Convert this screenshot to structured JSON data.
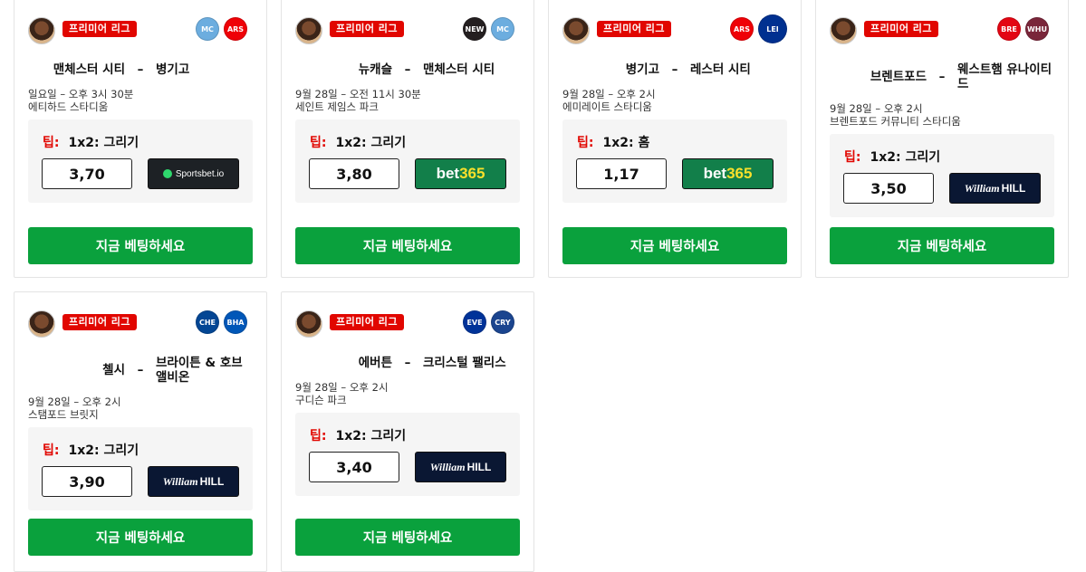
{
  "cards": [
    {
      "league": "프리미어 리그",
      "crest1": {
        "icon": "man-city-crest",
        "color": "#6caddf",
        "abbr": "MC"
      },
      "crest2": {
        "icon": "arsenal-crest",
        "color": "#ef0107",
        "abbr": "ARS"
      },
      "home": "맨체스터 시티",
      "dash": "–",
      "away": "병기고",
      "date": "일요일  – 오후 3시 30분",
      "venue": "에티하드 스타디움",
      "tip_label": "팁:",
      "tip_value": "1x2: 그리기",
      "odds": "3,70",
      "bookmaker": {
        "name": "Sportsbet.io",
        "style": "sportsbet"
      },
      "cta": "지금 베팅하세요"
    },
    {
      "league": "프리미어 리그",
      "crest1": {
        "icon": "newcastle-crest",
        "color": "#241f20",
        "abbr": "NEW"
      },
      "crest2": {
        "icon": "man-city-crest",
        "color": "#6caddf",
        "abbr": "MC"
      },
      "home": "뉴캐슬",
      "dash": "–",
      "away": "맨체스터 시티",
      "date": "9월 28일  – 오전 11시 30분",
      "venue": "세인트 제임스 파크",
      "tip_label": "팁:",
      "tip_value": "1x2: 그리기",
      "odds": "3,80",
      "bookmaker": {
        "name_a": "bet",
        "name_b": "365",
        "style": "bet365"
      },
      "cta": "지금 베팅하세요"
    },
    {
      "league": "프리미어 리그",
      "crest1": {
        "icon": "arsenal-crest",
        "color": "#ef0107",
        "abbr": "ARS"
      },
      "crest2": {
        "icon": "leicester-crest",
        "color": "#003090",
        "abbr": "LEI"
      },
      "home": "병기고",
      "dash": "–",
      "away": "레스터 시티",
      "date": "9월 28일  – 오후 2시",
      "venue": "에미레이트 스타디움",
      "tip_label": "팁:",
      "tip_value": "1x2: 홈",
      "odds": "1,17",
      "bookmaker": {
        "name_a": "bet",
        "name_b": "365",
        "style": "bet365"
      },
      "cta": "지금 베팅하세요"
    },
    {
      "league": "프리미어 리그",
      "crest1": {
        "icon": "brentford-crest",
        "color": "#e30613",
        "abbr": "BRE"
      },
      "crest2": {
        "icon": "west-ham-crest",
        "color": "#7a263a",
        "abbr": "WHU"
      },
      "home": "브렌트포드",
      "dash": "–",
      "away": "웨스트햄 유나이티드",
      "date": "9월 28일  – 오후 2시",
      "venue": "브렌트포드 커뮤니티 스타디움",
      "tip_label": "팁:",
      "tip_value": "1x2: 그리기",
      "odds": "3,50",
      "bookmaker": {
        "name_a": "William",
        "name_b": "HILL",
        "style": "wh"
      },
      "cta": "지금 베팅하세요"
    },
    {
      "league": "프리미어 리그",
      "crest1": {
        "icon": "chelsea-crest",
        "color": "#034694",
        "abbr": "CHE"
      },
      "crest2": {
        "icon": "brighton-crest",
        "color": "#0057b8",
        "abbr": "BHA"
      },
      "home": "첼시",
      "dash": "–",
      "away": "브라이튼 & 호브 앨비온",
      "date": "9월 28일  – 오후 2시",
      "venue": "스탬포드 브릿지",
      "tip_label": "팁:",
      "tip_value": "1x2: 그리기",
      "odds": "3,90",
      "bookmaker": {
        "name_a": "William",
        "name_b": "HILL",
        "style": "wh"
      },
      "cta": "지금 베팅하세요"
    },
    {
      "league": "프리미어 리그",
      "crest1": {
        "icon": "everton-crest",
        "color": "#003399",
        "abbr": "EVE"
      },
      "crest2": {
        "icon": "crystal-palace-crest",
        "color": "#1b458f",
        "abbr": "CRY"
      },
      "home": "에버튼",
      "dash": "–",
      "away": "크리스털 팰리스",
      "date": "9월 28일  – 오후 2시",
      "venue": "구디슨 파크",
      "tip_label": "팁:",
      "tip_value": "1x2: 그리기",
      "odds": "3,40",
      "bookmaker": {
        "name_a": "William",
        "name_b": "HILL",
        "style": "wh"
      },
      "cta": "지금 베팅하세요"
    }
  ]
}
